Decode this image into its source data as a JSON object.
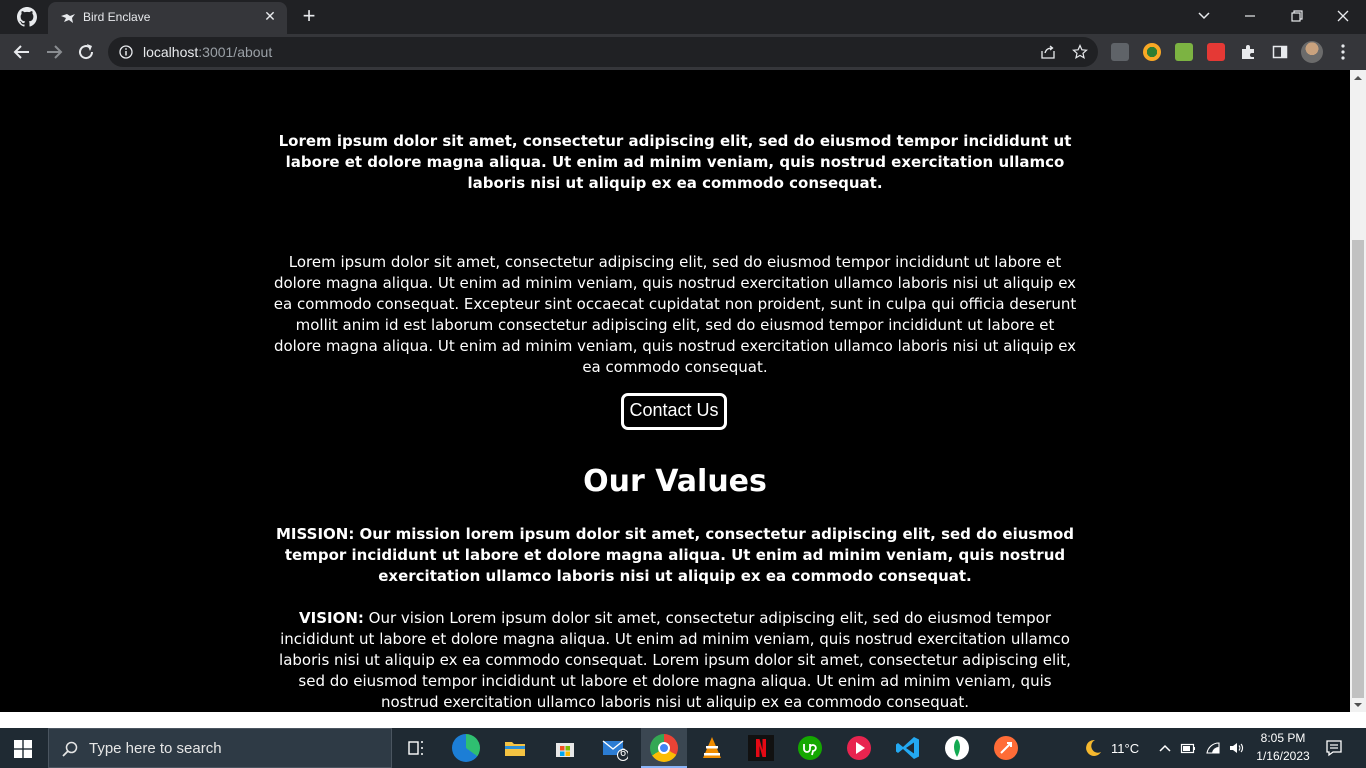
{
  "browser": {
    "tab_title": "Bird Enclave",
    "url_host": "localhost",
    "url_rest": ":3001/about"
  },
  "page": {
    "intro_bold": "Lorem ipsum dolor sit amet, consectetur adipiscing elit, sed do eiusmod tempor incididunt ut labore et dolore magna aliqua. Ut enim ad minim veniam, quis nostrud exercitation ullamco laboris nisi ut aliquip ex ea commodo consequat.",
    "intro_text": "Lorem ipsum dolor sit amet, consectetur adipiscing elit, sed do eiusmod tempor incididunt ut labore et dolore magna aliqua. Ut enim ad minim veniam, quis nostrud exercitation ullamco laboris nisi ut aliquip ex ea commodo consequat. Excepteur sint occaecat cupidatat non proident, sunt in culpa qui officia deserunt mollit anim id est laborum consectetur adipiscing elit, sed do eiusmod tempor incididunt ut labore et dolore magna aliqua. Ut enim ad minim veniam, quis nostrud exercitation ullamco laboris nisi ut aliquip ex ea commodo consequat.",
    "contact_button": "Contact Us",
    "values_heading": "Our Values",
    "mission_text": "MISSION: Our mission lorem ipsum dolor sit amet, consectetur adipiscing elit, sed do eiusmod tempor incididunt ut labore et dolore magna aliqua. Ut enim ad minim veniam, quis nostrud exercitation ullamco laboris nisi ut aliquip ex ea commodo consequat.",
    "vision_label": "VISION:",
    "vision_text": " Our vision Lorem ipsum dolor sit amet, consectetur adipiscing elit, sed do eiusmod tempor incididunt ut labore et dolore magna aliqua. Ut enim ad minim veniam, quis nostrud exercitation ullamco laboris nisi ut aliquip ex ea commodo consequat. Lorem ipsum dolor sit amet, consectetur adipiscing elit, sed do eiusmod tempor incididunt ut labore et dolore magna aliqua. Ut enim ad minim veniam, quis nostrud exercitation ullamco laboris nisi ut aliquip ex ea commodo consequat."
  },
  "taskbar": {
    "search_placeholder": "Type here to search",
    "mail_badge": "6",
    "temperature": "11°C",
    "time": "8:05 PM",
    "date": "1/16/2023"
  },
  "colors": {
    "page_bg": "#000000",
    "text": "#ffffff",
    "chrome_dark": "#202124",
    "chrome_toolbar": "#35363a",
    "taskbar_bg": "#1f2a33"
  }
}
